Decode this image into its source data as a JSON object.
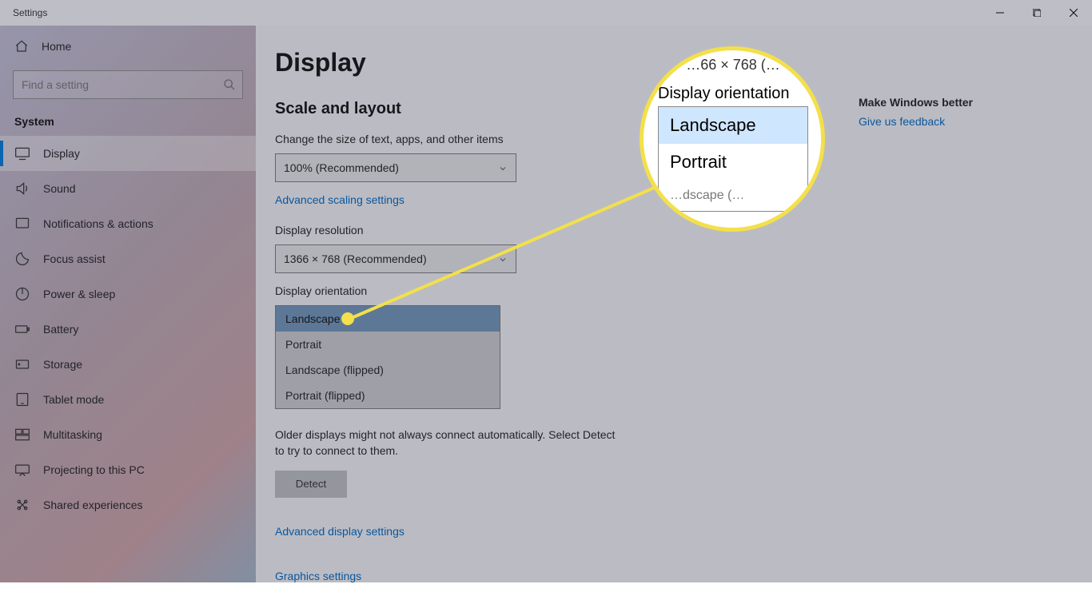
{
  "window": {
    "title": "Settings"
  },
  "sidebar": {
    "home": "Home",
    "search_placeholder": "Find a setting",
    "group": "System",
    "items": [
      {
        "label": "Display"
      },
      {
        "label": "Sound"
      },
      {
        "label": "Notifications & actions"
      },
      {
        "label": "Focus assist"
      },
      {
        "label": "Power & sleep"
      },
      {
        "label": "Battery"
      },
      {
        "label": "Storage"
      },
      {
        "label": "Tablet mode"
      },
      {
        "label": "Multitasking"
      },
      {
        "label": "Projecting to this PC"
      },
      {
        "label": "Shared experiences"
      }
    ]
  },
  "main": {
    "title": "Display",
    "section1": "Scale and layout",
    "scale_label": "Change the size of text, apps, and other items",
    "scale_value": "100% (Recommended)",
    "advanced_scaling": "Advanced scaling settings",
    "resolution_label": "Display resolution",
    "resolution_value": "1366 × 768 (Recommended)",
    "orientation_label": "Display orientation",
    "orientation_options": [
      "Landscape",
      "Portrait",
      "Landscape (flipped)",
      "Portrait (flipped)"
    ],
    "multi_text": "Older displays might not always connect automatically. Select Detect to try to connect to them.",
    "detect_btn": "Detect",
    "adv_display": "Advanced display settings",
    "graphics": "Graphics settings"
  },
  "right": {
    "heading": "Make Windows better",
    "feedback": "Give us feedback"
  },
  "callout": {
    "top": "…66 × 768 (…",
    "label": "Display orientation",
    "opt1": "Landscape",
    "opt2": "Portrait",
    "opt3": "…dscape (…"
  }
}
